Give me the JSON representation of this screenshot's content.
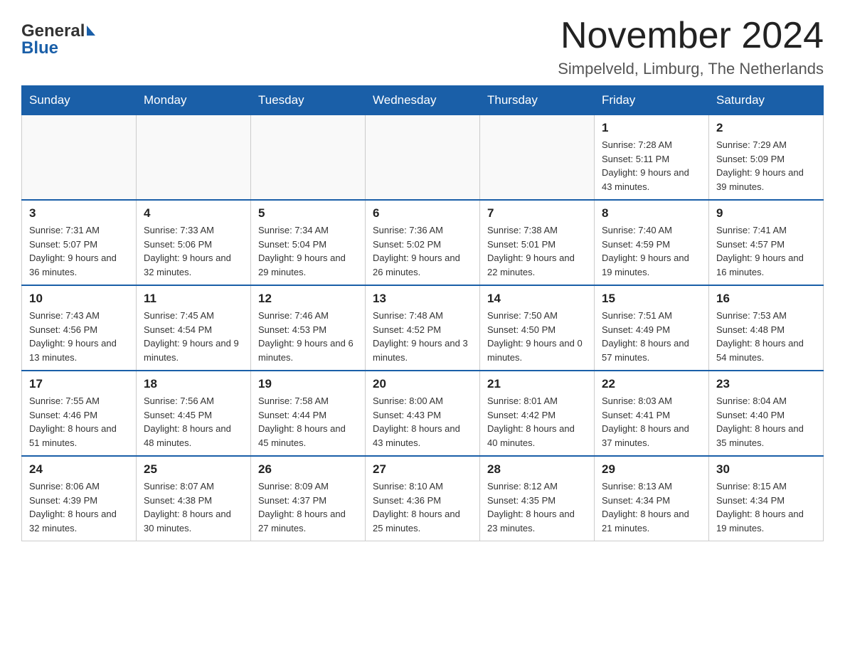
{
  "header": {
    "logo_line1": "General",
    "logo_line2": "Blue",
    "month_title": "November 2024",
    "location": "Simpelveld, Limburg, The Netherlands"
  },
  "days_of_week": [
    "Sunday",
    "Monday",
    "Tuesday",
    "Wednesday",
    "Thursday",
    "Friday",
    "Saturday"
  ],
  "weeks": [
    [
      {
        "day": "",
        "info": ""
      },
      {
        "day": "",
        "info": ""
      },
      {
        "day": "",
        "info": ""
      },
      {
        "day": "",
        "info": ""
      },
      {
        "day": "",
        "info": ""
      },
      {
        "day": "1",
        "info": "Sunrise: 7:28 AM\nSunset: 5:11 PM\nDaylight: 9 hours and 43 minutes."
      },
      {
        "day": "2",
        "info": "Sunrise: 7:29 AM\nSunset: 5:09 PM\nDaylight: 9 hours and 39 minutes."
      }
    ],
    [
      {
        "day": "3",
        "info": "Sunrise: 7:31 AM\nSunset: 5:07 PM\nDaylight: 9 hours and 36 minutes."
      },
      {
        "day": "4",
        "info": "Sunrise: 7:33 AM\nSunset: 5:06 PM\nDaylight: 9 hours and 32 minutes."
      },
      {
        "day": "5",
        "info": "Sunrise: 7:34 AM\nSunset: 5:04 PM\nDaylight: 9 hours and 29 minutes."
      },
      {
        "day": "6",
        "info": "Sunrise: 7:36 AM\nSunset: 5:02 PM\nDaylight: 9 hours and 26 minutes."
      },
      {
        "day": "7",
        "info": "Sunrise: 7:38 AM\nSunset: 5:01 PM\nDaylight: 9 hours and 22 minutes."
      },
      {
        "day": "8",
        "info": "Sunrise: 7:40 AM\nSunset: 4:59 PM\nDaylight: 9 hours and 19 minutes."
      },
      {
        "day": "9",
        "info": "Sunrise: 7:41 AM\nSunset: 4:57 PM\nDaylight: 9 hours and 16 minutes."
      }
    ],
    [
      {
        "day": "10",
        "info": "Sunrise: 7:43 AM\nSunset: 4:56 PM\nDaylight: 9 hours and 13 minutes."
      },
      {
        "day": "11",
        "info": "Sunrise: 7:45 AM\nSunset: 4:54 PM\nDaylight: 9 hours and 9 minutes."
      },
      {
        "day": "12",
        "info": "Sunrise: 7:46 AM\nSunset: 4:53 PM\nDaylight: 9 hours and 6 minutes."
      },
      {
        "day": "13",
        "info": "Sunrise: 7:48 AM\nSunset: 4:52 PM\nDaylight: 9 hours and 3 minutes."
      },
      {
        "day": "14",
        "info": "Sunrise: 7:50 AM\nSunset: 4:50 PM\nDaylight: 9 hours and 0 minutes."
      },
      {
        "day": "15",
        "info": "Sunrise: 7:51 AM\nSunset: 4:49 PM\nDaylight: 8 hours and 57 minutes."
      },
      {
        "day": "16",
        "info": "Sunrise: 7:53 AM\nSunset: 4:48 PM\nDaylight: 8 hours and 54 minutes."
      }
    ],
    [
      {
        "day": "17",
        "info": "Sunrise: 7:55 AM\nSunset: 4:46 PM\nDaylight: 8 hours and 51 minutes."
      },
      {
        "day": "18",
        "info": "Sunrise: 7:56 AM\nSunset: 4:45 PM\nDaylight: 8 hours and 48 minutes."
      },
      {
        "day": "19",
        "info": "Sunrise: 7:58 AM\nSunset: 4:44 PM\nDaylight: 8 hours and 45 minutes."
      },
      {
        "day": "20",
        "info": "Sunrise: 8:00 AM\nSunset: 4:43 PM\nDaylight: 8 hours and 43 minutes."
      },
      {
        "day": "21",
        "info": "Sunrise: 8:01 AM\nSunset: 4:42 PM\nDaylight: 8 hours and 40 minutes."
      },
      {
        "day": "22",
        "info": "Sunrise: 8:03 AM\nSunset: 4:41 PM\nDaylight: 8 hours and 37 minutes."
      },
      {
        "day": "23",
        "info": "Sunrise: 8:04 AM\nSunset: 4:40 PM\nDaylight: 8 hours and 35 minutes."
      }
    ],
    [
      {
        "day": "24",
        "info": "Sunrise: 8:06 AM\nSunset: 4:39 PM\nDaylight: 8 hours and 32 minutes."
      },
      {
        "day": "25",
        "info": "Sunrise: 8:07 AM\nSunset: 4:38 PM\nDaylight: 8 hours and 30 minutes."
      },
      {
        "day": "26",
        "info": "Sunrise: 8:09 AM\nSunset: 4:37 PM\nDaylight: 8 hours and 27 minutes."
      },
      {
        "day": "27",
        "info": "Sunrise: 8:10 AM\nSunset: 4:36 PM\nDaylight: 8 hours and 25 minutes."
      },
      {
        "day": "28",
        "info": "Sunrise: 8:12 AM\nSunset: 4:35 PM\nDaylight: 8 hours and 23 minutes."
      },
      {
        "day": "29",
        "info": "Sunrise: 8:13 AM\nSunset: 4:34 PM\nDaylight: 8 hours and 21 minutes."
      },
      {
        "day": "30",
        "info": "Sunrise: 8:15 AM\nSunset: 4:34 PM\nDaylight: 8 hours and 19 minutes."
      }
    ]
  ]
}
